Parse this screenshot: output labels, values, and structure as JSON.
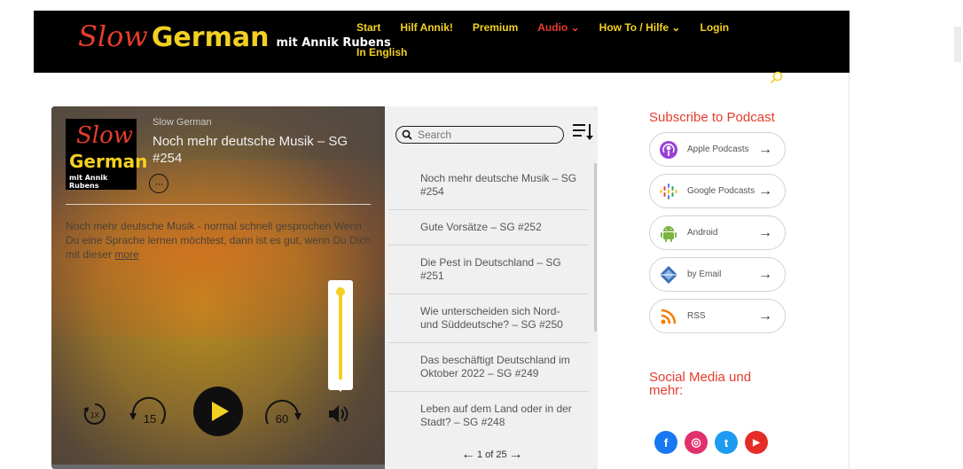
{
  "brand": {
    "slow": "Slow",
    "german": "German",
    "mit": "mit Annik Rubens"
  },
  "nav": {
    "row1": [
      "Start",
      "Hilf Annik!",
      "Premium",
      "Audio ⌄",
      "How To / Hilfe ⌄",
      "Login"
    ],
    "active_index": 3,
    "row2": "In English"
  },
  "player": {
    "cover": {
      "slow": "Slow",
      "german": "German",
      "mit": "mit Annik Rubens"
    },
    "show_name": "Slow German",
    "episode_title": "Noch mehr deutsche Musik – SG #254",
    "more_dots": "···",
    "description": "Noch mehr deutsche Musik - normal schnell gesprochen Wenn Du eine Sprache lernen möchtest, dann ist es gut, wenn Du Dich mit dieser",
    "more_link": "more",
    "speed": "1X",
    "skip_back": "15",
    "skip_forward": "60",
    "volume_level": 1.0
  },
  "playlist": {
    "search_placeholder": "Search",
    "items": [
      "Noch mehr deutsche Musik – SG #254",
      "Gute Vorsätze – SG #252",
      "Die Pest in Deutschland – SG #251",
      "Wie unterscheiden sich Nord- und Süddeutsche? – SG #250",
      "Das beschäftigt Deutschland im Oktober 2022 – SG #249",
      "Leben auf dem Land oder in der Stadt? – SG #248"
    ],
    "pager": "1 of 25"
  },
  "sidebar": {
    "subscribe_title": "Subscribe to Podcast",
    "buttons": [
      {
        "label": "Apple Podcasts",
        "icon": "apple-podcasts-icon",
        "color": "#9b3fd6"
      },
      {
        "label": "Google Podcasts",
        "icon": "google-podcasts-icon",
        "color": "#4285f4"
      },
      {
        "label": "Android",
        "icon": "android-icon",
        "color": "#7cb342"
      },
      {
        "label": "by Email",
        "icon": "email-icon",
        "color": "#3b6fb6"
      },
      {
        "label": "RSS",
        "icon": "rss-icon",
        "color": "#f57c00"
      }
    ],
    "social_title": "Social Media und mehr:",
    "social": [
      {
        "icon": "facebook-icon",
        "glyph": "f",
        "color": "#1877f2"
      },
      {
        "icon": "instagram-icon",
        "glyph": "◎",
        "color": "#e1306c"
      },
      {
        "icon": "twitter-icon",
        "glyph": "t",
        "color": "#1d9bf0"
      },
      {
        "icon": "youtube-icon",
        "glyph": "▶",
        "color": "#e52d27"
      }
    ]
  }
}
